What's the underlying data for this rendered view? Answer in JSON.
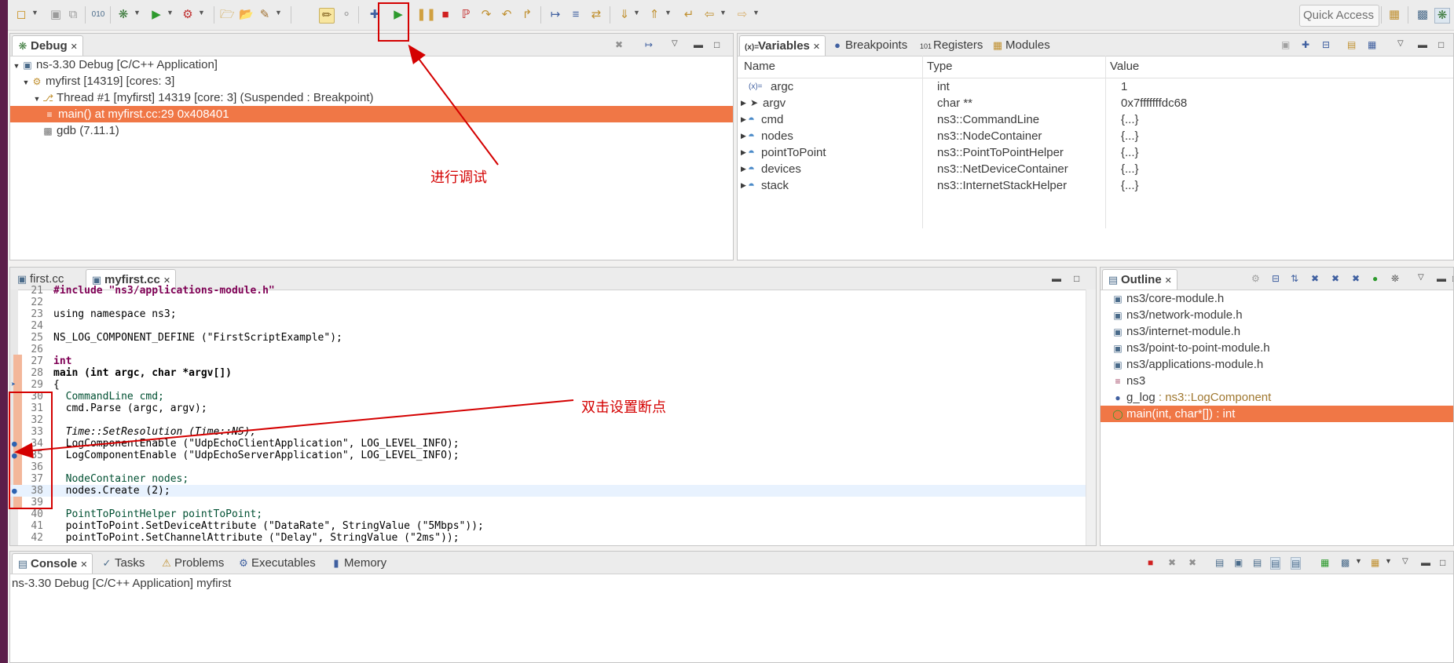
{
  "toolbar": {
    "quick_access": "Quick Access"
  },
  "debug_view": {
    "tab_label": "Debug",
    "tree": [
      {
        "label": "ns-3.30 Debug [C/C++ Application]"
      },
      {
        "label": "myfirst [14319] [cores: 3]"
      },
      {
        "label": "Thread #1 [myfirst] 14319 [core: 3] (Suspended : Breakpoint)"
      },
      {
        "label": "main() at myfirst.cc:29 0x408401"
      },
      {
        "label": "gdb (7.11.1)"
      }
    ]
  },
  "variables_view": {
    "tabs": [
      "Variables",
      "Breakpoints",
      "Registers",
      "Modules"
    ],
    "columns": [
      "Name",
      "Type",
      "Value"
    ],
    "rows": [
      {
        "name": "argc",
        "type": "int",
        "value": "1"
      },
      {
        "name": "argv",
        "type": "char **",
        "value": "0x7fffffffdc68"
      },
      {
        "name": "cmd",
        "type": "ns3::CommandLine",
        "value": "{...}"
      },
      {
        "name": "nodes",
        "type": "ns3::NodeContainer",
        "value": "{...}"
      },
      {
        "name": "pointToPoint",
        "type": "ns3::PointToPointHelper",
        "value": "{...}"
      },
      {
        "name": "devices",
        "type": "ns3::NetDeviceContainer",
        "value": "{...}"
      },
      {
        "name": "stack",
        "type": "ns3::InternetStackHelper",
        "value": "{...}"
      }
    ]
  },
  "editor": {
    "tabs": [
      "first.cc",
      "myfirst.cc"
    ],
    "lines": [
      {
        "num": "21",
        "text": "#include \"ns3/applications-module.h\""
      },
      {
        "num": "22",
        "text": ""
      },
      {
        "num": "23",
        "text": "using namespace ns3;"
      },
      {
        "num": "24",
        "text": ""
      },
      {
        "num": "25",
        "text": "NS_LOG_COMPONENT_DEFINE (\"FirstScriptExample\");"
      },
      {
        "num": "26",
        "text": ""
      },
      {
        "num": "27",
        "text": "int"
      },
      {
        "num": "28",
        "text": "main (int argc, char *argv[])"
      },
      {
        "num": "29",
        "text": "{"
      },
      {
        "num": "30",
        "text": "  CommandLine cmd;"
      },
      {
        "num": "31",
        "text": "  cmd.Parse (argc, argv);"
      },
      {
        "num": "32",
        "text": ""
      },
      {
        "num": "33",
        "text": "  Time::SetResolution (Time::NS);"
      },
      {
        "num": "34",
        "text": "  LogComponentEnable (\"UdpEchoClientApplication\", LOG_LEVEL_INFO);"
      },
      {
        "num": "35",
        "text": "  LogComponentEnable (\"UdpEchoServerApplication\", LOG_LEVEL_INFO);"
      },
      {
        "num": "36",
        "text": ""
      },
      {
        "num": "37",
        "text": "  NodeContainer nodes;"
      },
      {
        "num": "38",
        "text": "  nodes.Create (2);"
      },
      {
        "num": "39",
        "text": ""
      },
      {
        "num": "40",
        "text": "  PointToPointHelper pointToPoint;"
      },
      {
        "num": "41",
        "text": "  pointToPoint.SetDeviceAttribute (\"DataRate\", StringValue (\"5Mbps\"));"
      },
      {
        "num": "42",
        "text": "  pointToPoint.SetChannelAttribute (\"Delay\", StringValue (\"2ms\"));"
      }
    ]
  },
  "outline_view": {
    "tab_label": "Outline",
    "items": [
      {
        "label": "ns3/core-module.h"
      },
      {
        "label": "ns3/network-module.h"
      },
      {
        "label": "ns3/internet-module.h"
      },
      {
        "label": "ns3/point-to-point-module.h"
      },
      {
        "label": "ns3/applications-module.h"
      },
      {
        "label": "ns3"
      },
      {
        "label": "g_log",
        "type": " : ns3::LogComponent"
      },
      {
        "label": "main(int, char*[]) : int"
      }
    ]
  },
  "console_view": {
    "tabs": [
      "Console",
      "Tasks",
      "Problems",
      "Executables",
      "Memory"
    ],
    "content": "ns-3.30 Debug [C/C++ Application] myfirst"
  },
  "annotations": {
    "debug_label": "进行调试",
    "breakpoint_label": "双击设置断点"
  },
  "colors": {
    "selection": "#f07746",
    "annotation": "#d40000",
    "keyword": "#7f0055",
    "string": "#2a00ff"
  }
}
